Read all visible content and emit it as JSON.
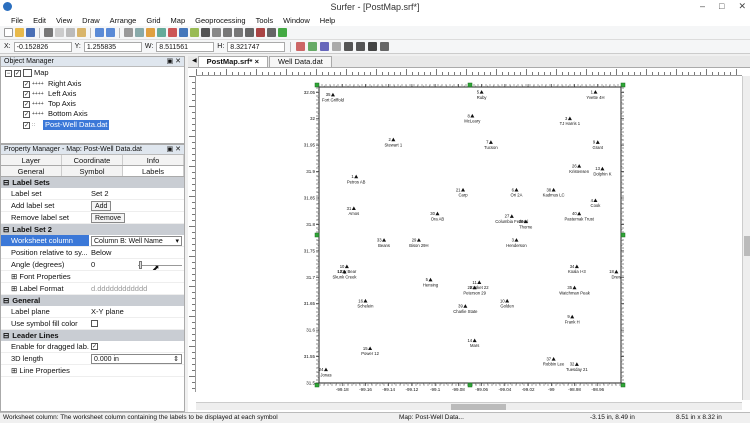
{
  "window": {
    "title": "Surfer - [PostMap.srf*]"
  },
  "menu": [
    "File",
    "Edit",
    "View",
    "Draw",
    "Arrange",
    "Grid",
    "Map",
    "Geoprocessing",
    "Tools",
    "Window",
    "Help"
  ],
  "coords": {
    "x_label": "X:",
    "x": "-0.152826",
    "y_label": "Y:",
    "y": "1.255835",
    "w_label": "W:",
    "w": "8.511561",
    "h_label": "H:",
    "h": "8.321747"
  },
  "object_manager": {
    "title": "Object Manager",
    "items": [
      {
        "label": "Map",
        "level": 0
      },
      {
        "label": "Right Axis",
        "level": 1
      },
      {
        "label": "Left Axis",
        "level": 1
      },
      {
        "label": "Top Axis",
        "level": 1
      },
      {
        "label": "Bottom Axis",
        "level": 1
      },
      {
        "label": "Post-Well Data.dat",
        "level": 1,
        "selected": true
      }
    ]
  },
  "property_manager": {
    "title": "Property Manager - Map: Post-Well Data.dat",
    "tabs_row1": [
      "Layer",
      "Coordinate System",
      "Info"
    ],
    "tabs_row2": [
      "General",
      "Symbol",
      "Labels"
    ],
    "active_tab": "Labels",
    "sections": {
      "label_sets": "Label Sets",
      "label_set_2": "Label Set 2",
      "general": "General",
      "leader_lines": "Leader Lines"
    },
    "rows": {
      "label_set": {
        "label": "Label set",
        "value": "Set 2"
      },
      "add_label_set": {
        "label": "Add label set",
        "button": "Add"
      },
      "remove_label_set": {
        "label": "Remove label set",
        "button": "Remove"
      },
      "worksheet_column": {
        "label": "Worksheet column",
        "value": "Column B:  Well Name"
      },
      "position": {
        "label": "Position relative to sy...",
        "value": "Below"
      },
      "angle": {
        "label": "Angle (degrees)",
        "value": "0"
      },
      "font_props": {
        "label": "Font Properties"
      },
      "label_format": {
        "label": "Label Format",
        "value": "d.dddddddddddd"
      },
      "label_plane": {
        "label": "Label plane",
        "value": "X-Y plane"
      },
      "symbol_fill": {
        "label": "Use symbol fill color"
      },
      "dragged": {
        "label": "Enable for dragged lab..."
      },
      "length3d": {
        "label": "3D length",
        "value": "0.000 in"
      },
      "line_props": {
        "label": "Line Properties"
      }
    }
  },
  "doc_tabs": [
    "PostMap.srf*",
    "Well Data.dat"
  ],
  "status": {
    "help": "Worksheet column: The worksheet column containing the labels to be displayed at each symbol",
    "selection": "Map: Post-Well Data...",
    "cursor": "-3.15 in, 8.49 in",
    "size": "8.51 in x 8.32 in"
  },
  "chart_data": {
    "type": "scatter",
    "title": "",
    "xlabel": "",
    "ylabel": "",
    "xlim": [
      -99.2,
      -98.94
    ],
    "ylim": [
      31.5,
      32.06
    ],
    "x_ticks": [
      "-99.18",
      "-99.16",
      "-99.14",
      "-99.12",
      "-99.1",
      "-99.08",
      "-99.06",
      "-99.04",
      "-99.02",
      "-99",
      "-98.98",
      "-98.96"
    ],
    "y_ticks": [
      "31.5",
      "31.55",
      "31.6",
      "31.65",
      "31.7",
      "31.75",
      "31.8",
      "31.85",
      "31.9",
      "31.95",
      "32",
      "32.05"
    ],
    "points": [
      {
        "id": "35",
        "name": "Fort Griffold",
        "x": -99.188,
        "y": 32.045
      },
      {
        "id": "5",
        "name": "Ruby",
        "x": -99.06,
        "y": 32.05
      },
      {
        "id": "1",
        "name": "Yvette 4H",
        "x": -98.962,
        "y": 32.05
      },
      {
        "id": "8",
        "name": "McLeary",
        "x": -99.068,
        "y": 32.005
      },
      {
        "id": "3",
        "name": "TJ Harris 1",
        "x": -98.984,
        "y": 32.0
      },
      {
        "id": "2",
        "name": "Stewart 1",
        "x": -99.136,
        "y": 31.96
      },
      {
        "id": "7",
        "name": "Tucson",
        "x": -99.052,
        "y": 31.955
      },
      {
        "id": "9",
        "name": "Grant",
        "x": -98.96,
        "y": 31.955
      },
      {
        "id": "26",
        "name": "Kristensen",
        "x": -98.976,
        "y": 31.91
      },
      {
        "id": "13",
        "name": "Dolphin K",
        "x": -98.956,
        "y": 31.905
      },
      {
        "id": "1",
        "name": "Petros AB",
        "x": -99.168,
        "y": 31.89
      },
      {
        "id": "21",
        "name": "Carp",
        "x": -99.076,
        "y": 31.865
      },
      {
        "id": "6",
        "name": "Ori 2A",
        "x": -99.03,
        "y": 31.865
      },
      {
        "id": "38",
        "name": "Kadmus LC",
        "x": -98.998,
        "y": 31.865
      },
      {
        "id": "4",
        "name": "Cook",
        "x": -98.962,
        "y": 31.845
      },
      {
        "id": "31",
        "name": "Amos",
        "x": -99.17,
        "y": 31.83
      },
      {
        "id": "30",
        "name": "Ora AB",
        "x": -99.098,
        "y": 31.82
      },
      {
        "id": "40",
        "name": "Pasternak Trust",
        "x": -98.976,
        "y": 31.82
      },
      {
        "id": "27",
        "name": "Columbia Federal",
        "x": -99.034,
        "y": 31.815
      },
      {
        "id": "28",
        "name": "Thorne",
        "x": -99.022,
        "y": 31.805
      },
      {
        "id": "33",
        "name": "Beans",
        "x": -99.144,
        "y": 31.77
      },
      {
        "id": "29",
        "name": "Bison 29H",
        "x": -99.114,
        "y": 31.77
      },
      {
        "id": "3",
        "name": "Henderson",
        "x": -99.03,
        "y": 31.77
      },
      {
        "id": "10",
        "name": "Lazy Bear",
        "x": -99.176,
        "y": 31.72
      },
      {
        "id": "17",
        "name": "Skunk Creek",
        "x": -99.178,
        "y": 31.71
      },
      {
        "id": "34",
        "name": "Koala I+3",
        "x": -98.978,
        "y": 31.72
      },
      {
        "id": "18",
        "name": "Drew",
        "x": -98.944,
        "y": 31.71
      },
      {
        "id": "5",
        "name": "Hensing",
        "x": -99.104,
        "y": 31.695
      },
      {
        "id": "11",
        "name": "Kasket 22",
        "x": -99.062,
        "y": 31.69
      },
      {
        "id": "22",
        "name": "Peterson 29",
        "x": -99.066,
        "y": 31.68
      },
      {
        "id": "35",
        "name": "Watchman Peak",
        "x": -98.98,
        "y": 31.68
      },
      {
        "id": "16",
        "name": "Schelein",
        "x": -99.16,
        "y": 31.655
      },
      {
        "id": "10",
        "name": "Golden",
        "x": -99.038,
        "y": 31.655
      },
      {
        "id": "39",
        "name": "Charlie State",
        "x": -99.074,
        "y": 31.645
      },
      {
        "id": "9",
        "name": "Frank H",
        "x": -98.982,
        "y": 31.625
      },
      {
        "id": "14",
        "name": "Mars",
        "x": -99.066,
        "y": 31.58
      },
      {
        "id": "15",
        "name": "Power 12",
        "x": -99.156,
        "y": 31.565
      },
      {
        "id": "37",
        "name": "Robbin Lee",
        "x": -98.998,
        "y": 31.545
      },
      {
        "id": "32",
        "name": "Tuesday 21",
        "x": -98.978,
        "y": 31.535
      },
      {
        "id": "24",
        "name": "Jonas",
        "x": -99.194,
        "y": 31.525
      }
    ]
  }
}
